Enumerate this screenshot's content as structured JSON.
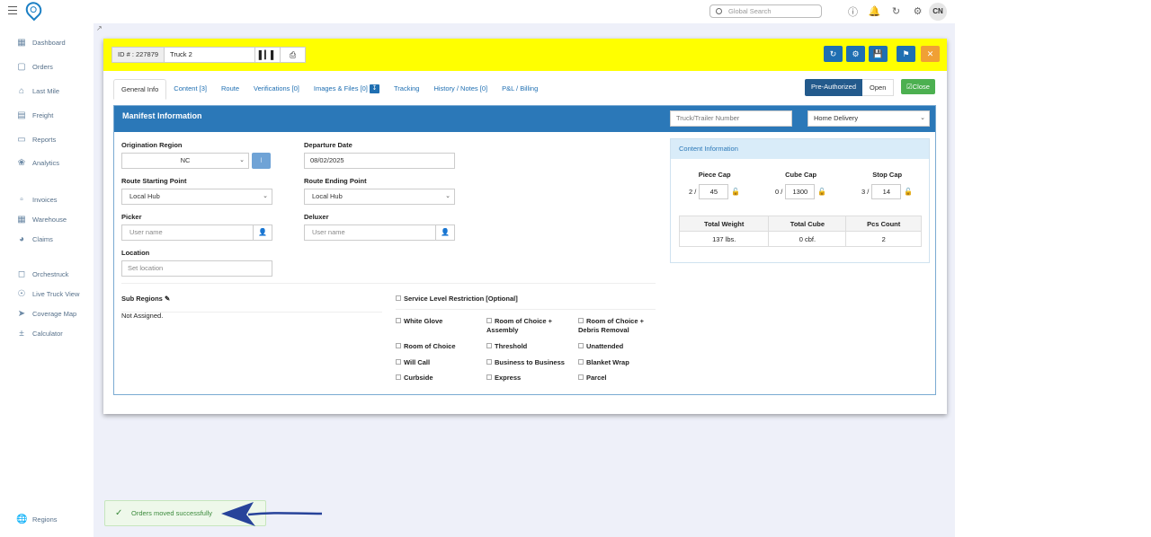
{
  "header": {
    "search_placeholder": "Global Search",
    "user_initials": "CN",
    "icons": [
      "help-icon",
      "bell-icon",
      "history-icon",
      "gear-icon"
    ]
  },
  "sidebar": {
    "items": [
      {
        "label": "Dashboard",
        "icon": "dashboard-icon"
      },
      {
        "label": "Orders",
        "icon": "box-icon"
      },
      {
        "label": "Last Mile",
        "icon": "home-icon"
      },
      {
        "label": "Freight",
        "icon": "truck-icon"
      },
      {
        "label": "Reports",
        "icon": "report-icon"
      },
      {
        "label": "Analytics",
        "icon": "analytics-icon"
      },
      {
        "label": "Invoices",
        "icon": "invoice-icon"
      },
      {
        "label": "Warehouse",
        "icon": "warehouse-icon"
      },
      {
        "label": "Claims",
        "icon": "headset-icon"
      },
      {
        "label": "Orchestruck",
        "icon": "orchestruck-icon"
      },
      {
        "label": "Live Truck View",
        "icon": "live-view-icon"
      },
      {
        "label": "Coverage Map",
        "icon": "map-arrow-icon"
      },
      {
        "label": "Calculator",
        "icon": "calculator-icon"
      }
    ],
    "bottom_item": {
      "label": "Regions",
      "icon": "globe-icon"
    }
  },
  "modal": {
    "id_label": "ID # : 227879",
    "truck_name": "Truck 2",
    "tabs": [
      {
        "label": "General Info"
      },
      {
        "label": "Content [3]"
      },
      {
        "label": "Route"
      },
      {
        "label": "Verifications [0]"
      },
      {
        "label": "Images & Files [0]"
      },
      {
        "label": "Tracking"
      },
      {
        "label": "History / Notes [0]"
      },
      {
        "label": "P&L / Billing"
      }
    ],
    "status_pre": "Pre-Authorized",
    "status_open": "Open",
    "close_label": "Close",
    "panel_title": "Manifest Information",
    "truck_trailer_placeholder": "Truck/Trailer Number",
    "delivery_type": "Home Delivery",
    "fields": {
      "origination_region_label": "Origination Region",
      "origination_region_value": "NC",
      "departure_date_label": "Departure Date",
      "departure_date_value": "08/02/2025",
      "route_start_label": "Route Starting Point",
      "route_start_value": "Local Hub",
      "route_end_label": "Route Ending Point",
      "route_end_value": "Local Hub",
      "picker_label": "Picker",
      "picker_placeholder": "User name",
      "deluxer_label": "Deluxer",
      "deluxer_placeholder": "User name",
      "location_label": "Location",
      "location_placeholder": "Set location"
    },
    "content_info": {
      "title": "Content Information",
      "piece_cap_label": "Piece Cap",
      "piece_cap_count": "2 /",
      "piece_cap_value": "45",
      "cube_cap_label": "Cube Cap",
      "cube_cap_count": "0 /",
      "cube_cap_value": "1300",
      "stop_cap_label": "Stop Cap",
      "stop_cap_count": "3 /",
      "stop_cap_value": "14",
      "table_headers": [
        "Total Weight",
        "Total Cube",
        "Pcs Count"
      ],
      "table_values": [
        "137 lbs.",
        "0 cbf.",
        "2"
      ]
    },
    "sub_regions_label": "Sub Regions",
    "sub_regions_value": "Not Assigned.",
    "service_level_label": "Service Level Restriction [Optional]",
    "service_options": [
      "White Glove",
      "Room of Choice + Assembly",
      "Room of Choice + Debris Removal",
      "Room of Choice",
      "Threshold",
      "Unattended",
      "Will Call",
      "Business to Business",
      "Blanket Wrap",
      "Curbside",
      "Express",
      "Parcel"
    ]
  },
  "toast": {
    "message": "Orders moved successfully",
    "arrow_color": "#27439a"
  }
}
